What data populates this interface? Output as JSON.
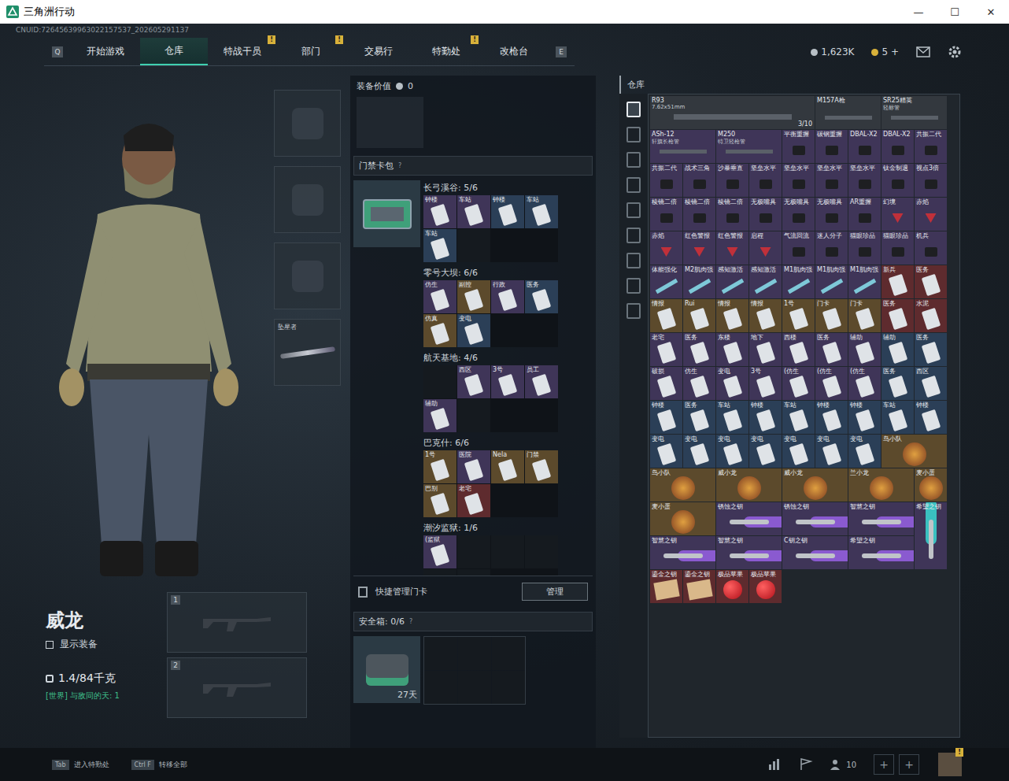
{
  "window": {
    "title": "三角洲行动",
    "controls": [
      "—",
      "☐",
      "✕"
    ]
  },
  "uid": "CNUID:72645639963022157537_202605291137",
  "nav": {
    "left_key": "Q",
    "right_key": "E",
    "tabs": [
      {
        "label": "开始游戏",
        "selected": false,
        "badge": ""
      },
      {
        "label": "仓库",
        "selected": true,
        "badge": ""
      },
      {
        "label": "特战干员",
        "selected": false,
        "badge": "!"
      },
      {
        "label": "部门",
        "selected": false,
        "badge": "!"
      },
      {
        "label": "交易行",
        "selected": false,
        "badge": ""
      },
      {
        "label": "特勤处",
        "selected": false,
        "badge": "!"
      },
      {
        "label": "改枪台",
        "selected": false,
        "badge": ""
      }
    ]
  },
  "currency": [
    {
      "amount": "1,623K",
      "kind": "coin"
    },
    {
      "amount": "5 +",
      "kind": "bond"
    }
  ],
  "operator": {
    "name": "威龙",
    "show_gear": {
      "label": "显示装备",
      "checked": false
    },
    "weight": "1.4/84千克",
    "chat": "[世界] 与敌同的天: 1"
  },
  "gear_slots": [
    {
      "kind": "helmet",
      "item": ""
    },
    {
      "kind": "armor",
      "item": ""
    },
    {
      "kind": "pistol",
      "item": ""
    },
    {
      "kind": "melee",
      "item": "坠星者"
    }
  ],
  "weapon_slots": [
    "1",
    "2"
  ],
  "loadout": {
    "label": "装备价值",
    "value": "0"
  },
  "keycard_case": {
    "title": "门禁卡包",
    "help": "?",
    "regions": [
      {
        "name": "长弓溪谷: 5/6",
        "slots": [
          {
            "name": "钟楼",
            "color": "#3f3558"
          },
          {
            "name": "车站",
            "color": "#3f3558"
          },
          {
            "name": "钟楼",
            "color": "#2b3f57"
          },
          {
            "name": "车站",
            "color": "#2b3f57"
          },
          {
            "name": "车站",
            "color": "#2b3f57"
          },
          {
            "name": "",
            "color": "#151a1f"
          }
        ]
      },
      {
        "name": "零号大坝: 6/6",
        "slots": [
          {
            "name": "仿生",
            "color": "#3f3558"
          },
          {
            "name": "副控",
            "color": "#5c4a2c"
          },
          {
            "name": "行政",
            "color": "#3f3558"
          },
          {
            "name": "医务",
            "color": "#2b3f57"
          },
          {
            "name": "仿真",
            "color": "#5c4a2c"
          },
          {
            "name": "变电",
            "color": "#2b3f57"
          }
        ]
      },
      {
        "name": "航天基地: 4/6",
        "slots": [
          {
            "name": "",
            "color": "#151a1f"
          },
          {
            "name": "西区",
            "color": "#3f3558"
          },
          {
            "name": "3号",
            "color": "#3f3558"
          },
          {
            "name": "员工",
            "color": "#3f3558"
          },
          {
            "name": "辅助",
            "color": "#3f3558"
          },
          {
            "name": "",
            "color": "#151a1f"
          }
        ]
      },
      {
        "name": "巴克什: 6/6",
        "slots": [
          {
            "name": "1号",
            "color": "#5c4a2c"
          },
          {
            "name": "医院",
            "color": "#3f3558"
          },
          {
            "name": "Nela",
            "color": "#5c4a2c"
          },
          {
            "name": "门禁",
            "color": "#5c4a2c"
          },
          {
            "name": "巴别",
            "color": "#5c4a2c"
          },
          {
            "name": "老宅",
            "color": "#5e2b2e"
          }
        ]
      },
      {
        "name": "潮汐监狱: 1/6",
        "slots": [
          {
            "name": "(监狱",
            "color": "#3f3558"
          },
          {
            "name": "",
            "color": "#151a1f"
          },
          {
            "name": "",
            "color": "#151a1f"
          },
          {
            "name": "",
            "color": "#151a1f"
          },
          {
            "name": "",
            "color": "#151a1f"
          },
          {
            "name": "",
            "color": "#151a1f"
          }
        ]
      }
    ],
    "quick": {
      "label": "快捷管理门卡",
      "button": "管理"
    }
  },
  "safe_box": {
    "title": "安全箱: 0/6",
    "help": "?",
    "duration": "27天"
  },
  "storage": {
    "title": "仓库",
    "items": [
      {
        "name": "R93",
        "sub": "7.62x51mm",
        "count": "3/10",
        "kind": "longgun",
        "color": "#33383e"
      },
      {
        "name": "M157A枪",
        "kind": "gun",
        "color": "#33383e"
      },
      {
        "name": "SR25精英",
        "sub": "轻标管",
        "kind": "gun",
        "color": "#33383e"
      },
      {
        "name": "ASh-12",
        "sub": "轩旗长枪管",
        "kind": "barrel",
        "color": "#3f3558"
      },
      {
        "name": "M250",
        "sub": "特卫轻枪管",
        "kind": "barrel",
        "color": "#3f3558"
      },
      {
        "name": "平衡重握",
        "kind": "part",
        "color": "#3f3558"
      },
      {
        "name": "碳钢重握",
        "kind": "part",
        "color": "#3f3558"
      },
      {
        "name": "DBAL-X2",
        "kind": "part",
        "color": "#3f3558"
      },
      {
        "name": "DBAL-X2",
        "kind": "part",
        "color": "#3f3558"
      },
      {
        "name": "共振二代",
        "kind": "part",
        "color": "#3f3558"
      },
      {
        "name": "共振二代",
        "kind": "part",
        "color": "#3f3558"
      },
      {
        "name": "战术三角",
        "kind": "part",
        "color": "#3f3558"
      },
      {
        "name": "沙暴垂直",
        "kind": "part",
        "color": "#3f3558"
      },
      {
        "name": "坚垒水平",
        "kind": "part",
        "color": "#3f3558"
      },
      {
        "name": "坚垒水平",
        "kind": "part",
        "color": "#3f3558"
      },
      {
        "name": "坚垒水平",
        "kind": "part",
        "color": "#3f3558"
      },
      {
        "name": "坚垒水平",
        "kind": "part",
        "color": "#3f3558"
      },
      {
        "name": "钛金制退",
        "kind": "part",
        "color": "#3f3558"
      },
      {
        "name": "视点3倍",
        "kind": "part",
        "color": "#3f3558"
      },
      {
        "name": "棱镜二倍",
        "kind": "part",
        "color": "#3f3558"
      },
      {
        "name": "棱镜二倍",
        "kind": "part",
        "color": "#3f3558"
      },
      {
        "name": "棱镜二倍",
        "kind": "part",
        "color": "#3f3558"
      },
      {
        "name": "无极嘴具",
        "kind": "part",
        "color": "#3f3558"
      },
      {
        "name": "无极嘴具",
        "kind": "part",
        "color": "#3f3558"
      },
      {
        "name": "无极嘴具",
        "kind": "part",
        "color": "#3f3558"
      },
      {
        "name": "AR重握",
        "kind": "part",
        "color": "#3f3558"
      },
      {
        "name": "幻境",
        "kind": "drink",
        "color": "#3f3558"
      },
      {
        "name": "赤焰",
        "kind": "drink",
        "color": "#3f3558"
      },
      {
        "name": "赤焰",
        "kind": "drink",
        "color": "#3f3558"
      },
      {
        "name": "红色警报",
        "kind": "drink",
        "color": "#3f3558"
      },
      {
        "name": "红色警报",
        "kind": "drink",
        "color": "#3f3558"
      },
      {
        "name": "启程",
        "kind": "drink",
        "color": "#3f3558"
      },
      {
        "name": "气流回流",
        "kind": "part",
        "color": "#3f3558"
      },
      {
        "name": "迷人分子",
        "kind": "part",
        "color": "#3f3558"
      },
      {
        "name": "猫眼珍品",
        "kind": "part",
        "color": "#3f3558"
      },
      {
        "name": "猫眼珍品",
        "kind": "part",
        "color": "#3f3558"
      },
      {
        "name": "机兵",
        "kind": "part",
        "color": "#3f3558"
      },
      {
        "name": "体能强化",
        "kind": "syringe",
        "color": "#3f3558"
      },
      {
        "name": "M2肌肉强",
        "kind": "syringe",
        "color": "#3f3558"
      },
      {
        "name": "感知激活",
        "kind": "syringe",
        "color": "#3f3558"
      },
      {
        "name": "感知激活",
        "kind": "syringe",
        "color": "#3f3558"
      },
      {
        "name": "M1肌肉强",
        "kind": "syringe",
        "color": "#3f3558"
      },
      {
        "name": "M1肌肉强",
        "kind": "syringe",
        "color": "#3f3558"
      },
      {
        "name": "M1肌肉强",
        "kind": "syringe",
        "color": "#3f3558"
      },
      {
        "name": "新兵",
        "kind": "card",
        "color": "#5e2b2e"
      },
      {
        "name": "医务",
        "kind": "card",
        "color": "#5e2b2e"
      },
      {
        "name": "情报",
        "kind": "card",
        "color": "#5c4a2c"
      },
      {
        "name": "Rui",
        "kind": "card",
        "color": "#5c4a2c"
      },
      {
        "name": "情报",
        "kind": "card",
        "color": "#5c4a2c"
      },
      {
        "name": "情报",
        "kind": "card",
        "color": "#5c4a2c"
      },
      {
        "name": "1号",
        "kind": "card",
        "color": "#5c4a2c"
      },
      {
        "name": "门卡",
        "kind": "card",
        "color": "#5c4a2c"
      },
      {
        "name": "门卡",
        "kind": "card",
        "color": "#5c4a2c"
      },
      {
        "name": "医务",
        "kind": "card",
        "color": "#5e2b2e"
      },
      {
        "name": "水泥",
        "kind": "card",
        "color": "#5e2b2e"
      },
      {
        "name": "老宅",
        "kind": "card",
        "color": "#3f3558"
      },
      {
        "name": "医务",
        "kind": "card",
        "color": "#3f3558"
      },
      {
        "name": "东楼",
        "kind": "card",
        "color": "#3f3558"
      },
      {
        "name": "地下",
        "kind": "card",
        "color": "#3f3558"
      },
      {
        "name": "西楼",
        "kind": "card",
        "color": "#3f3558"
      },
      {
        "name": "医务",
        "kind": "card",
        "color": "#3f3558"
      },
      {
        "name": "辅助",
        "kind": "card",
        "color": "#3f3558"
      },
      {
        "name": "辅助",
        "kind": "card",
        "color": "#2b3f57"
      },
      {
        "name": "医务",
        "kind": "card",
        "color": "#2b3f57"
      },
      {
        "name": "破损",
        "kind": "card",
        "color": "#3f3558"
      },
      {
        "name": "仿生",
        "kind": "card",
        "color": "#3f3558"
      },
      {
        "name": "变电",
        "kind": "card",
        "color": "#3f3558"
      },
      {
        "name": "3号",
        "kind": "card",
        "color": "#3f3558"
      },
      {
        "name": "(仿生",
        "kind": "card",
        "color": "#3f3558"
      },
      {
        "name": "(仿生",
        "kind": "card",
        "color": "#3f3558"
      },
      {
        "name": "(仿生",
        "kind": "card",
        "color": "#3f3558"
      },
      {
        "name": "医务",
        "kind": "card",
        "color": "#2b3f57"
      },
      {
        "name": "西区",
        "kind": "card",
        "color": "#2b3f57"
      },
      {
        "name": "钟楼",
        "kind": "card",
        "color": "#2b3f57"
      },
      {
        "name": "医务",
        "kind": "card",
        "color": "#2b3f57"
      },
      {
        "name": "车站",
        "kind": "card",
        "color": "#2b3f57"
      },
      {
        "name": "钟楼",
        "kind": "card",
        "color": "#2b3f57"
      },
      {
        "name": "车站",
        "kind": "card",
        "color": "#2b3f57"
      },
      {
        "name": "钟楼",
        "kind": "card",
        "color": "#2b3f57"
      },
      {
        "name": "钟楼",
        "kind": "card",
        "color": "#2b3f57"
      },
      {
        "name": "车站",
        "kind": "card",
        "color": "#2b3f57"
      },
      {
        "name": "钟楼",
        "kind": "card",
        "color": "#2b3f57"
      },
      {
        "name": "变电",
        "kind": "card",
        "color": "#2b3f57"
      },
      {
        "name": "变电",
        "kind": "card",
        "color": "#2b3f57"
      },
      {
        "name": "变电",
        "kind": "card",
        "color": "#2b3f57"
      },
      {
        "name": "变电",
        "kind": "card",
        "color": "#2b3f57"
      },
      {
        "name": "变电",
        "kind": "card",
        "color": "#2b3f57"
      },
      {
        "name": "变电",
        "kind": "card",
        "color": "#2b3f57"
      },
      {
        "name": "变电",
        "kind": "card",
        "color": "#2b3f57"
      },
      {
        "name": "鸟小队",
        "kind": "figure",
        "color": "#5c4a2c"
      },
      {
        "name": "鸟小队",
        "kind": "figure",
        "color": "#5c4a2c"
      },
      {
        "name": "威小龙",
        "kind": "figure",
        "color": "#5c4a2c"
      },
      {
        "name": "威小龙",
        "kind": "figure",
        "color": "#5c4a2c"
      },
      {
        "name": "兰小龙",
        "kind": "figure",
        "color": "#5c4a2c"
      },
      {
        "name": "麦小蛋",
        "kind": "egg",
        "color": "#5c4a2c"
      },
      {
        "name": "麦小蛋",
        "kind": "figure",
        "color": "#5c4a2c"
      },
      {
        "name": "锈蚀之钥",
        "kind": "key",
        "color": "#3f3558"
      },
      {
        "name": "锈蚀之钥",
        "kind": "key",
        "color": "#3f3558"
      },
      {
        "name": "智慧之钥",
        "kind": "key",
        "color": "#3f3558"
      },
      {
        "name": "希望之钥",
        "kind": "keytall",
        "color": "#3f3558"
      },
      {
        "name": "智慧之钥",
        "kind": "key",
        "color": "#3f3558"
      },
      {
        "name": "智慧之钥",
        "kind": "key",
        "color": "#3f3558"
      },
      {
        "name": "C钥之钥",
        "kind": "key",
        "color": "#3f3558"
      },
      {
        "name": "希望之钥",
        "kind": "key",
        "color": "#3f3558"
      },
      {
        "name": "鎏金之钥",
        "kind": "ticket",
        "color": "#5e2b2e"
      },
      {
        "name": "鎏金之钥",
        "kind": "ticket",
        "color": "#5e2b2e"
      },
      {
        "name": "极品苹果",
        "kind": "food",
        "color": "#5e2b2e"
      },
      {
        "name": "极品苹果",
        "kind": "food",
        "color": "#5e2b2e"
      }
    ]
  },
  "bottom_bar": {
    "hints": [
      {
        "key": "Tab",
        "label": "进入特勤处"
      },
      {
        "key": "Ctrl F",
        "label": "转移全部"
      }
    ],
    "friends": "10",
    "add_slots": [
      "+",
      "+"
    ],
    "avatar_badge": "!"
  }
}
